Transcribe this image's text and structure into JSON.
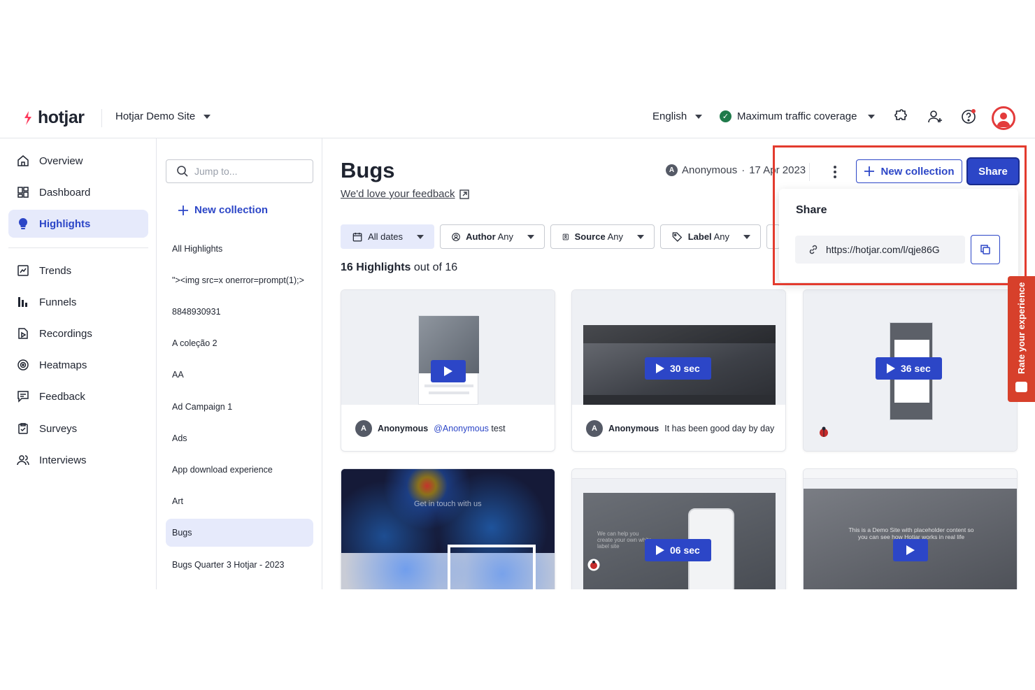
{
  "brand": {
    "name": "hotjar",
    "accent": "#2c46c7",
    "logo_color": "#fd3a5c"
  },
  "topbar": {
    "site": "Hotjar Demo Site",
    "language": "English",
    "traffic": "Maximum traffic coverage"
  },
  "nav": {
    "items": [
      {
        "label": "Overview",
        "icon": "home-icon"
      },
      {
        "label": "Dashboard",
        "icon": "dashboard-icon"
      },
      {
        "label": "Highlights",
        "icon": "lightbulb-icon",
        "active": true
      },
      {
        "label": "Trends",
        "icon": "trends-icon"
      },
      {
        "label": "Funnels",
        "icon": "funnels-icon"
      },
      {
        "label": "Recordings",
        "icon": "recordings-icon"
      },
      {
        "label": "Heatmaps",
        "icon": "heatmaps-icon"
      },
      {
        "label": "Feedback",
        "icon": "feedback-icon"
      },
      {
        "label": "Surveys",
        "icon": "surveys-icon"
      },
      {
        "label": "Interviews",
        "icon": "interviews-icon"
      }
    ]
  },
  "collections": {
    "search_placeholder": "Jump to...",
    "new_label": "New collection",
    "items": [
      "All Highlights",
      "\"><img src=x onerror=prompt(1);>",
      "8848930931",
      "A coleção 2",
      "AA",
      "Ad Campaign 1",
      "Ads",
      "App download experience",
      "Art",
      "Bugs",
      "Bugs Quarter 3 Hotjar - 2023"
    ],
    "active": "Bugs"
  },
  "main": {
    "title": "Bugs",
    "feedback_link": "We'd love your feedback",
    "meta_author": "Anonymous",
    "meta_sep": "·",
    "meta_date": "17 Apr 2023",
    "new_collection": "New collection",
    "share": "Share",
    "filters": [
      {
        "label": "All dates",
        "value": "",
        "icon": "calendar-icon"
      },
      {
        "label": "Author",
        "value": "Any",
        "icon": "user-circle-icon"
      },
      {
        "label": "Source",
        "value": "Any",
        "icon": "source-icon"
      },
      {
        "label": "Label",
        "value": "Any",
        "icon": "tag-icon"
      }
    ],
    "count_bold": "16 Highlights",
    "count_rest": " out of 16",
    "cards": [
      {
        "duration": "",
        "author": "Anonymous",
        "mention": "@Anonymous",
        "text": "test"
      },
      {
        "duration": "30 sec",
        "author": "Anonymous",
        "mention": "",
        "text": "It has been good day by day"
      },
      {
        "duration": "36 sec",
        "author": "",
        "mention": "",
        "text": ""
      },
      {
        "duration": "",
        "heatmap_text": "Get in touch with us"
      },
      {
        "duration": "06 sec",
        "thumb_text": "We can help you create your own white label site"
      },
      {
        "duration": "",
        "thumb_text": "This is a Demo Site with placeholder content so you can see how Hotjar works in real life"
      }
    ]
  },
  "share_popover": {
    "title": "Share",
    "url": "https://hotjar.com/l/qje86G"
  },
  "rate_tab": {
    "label": "Rate your experience"
  }
}
